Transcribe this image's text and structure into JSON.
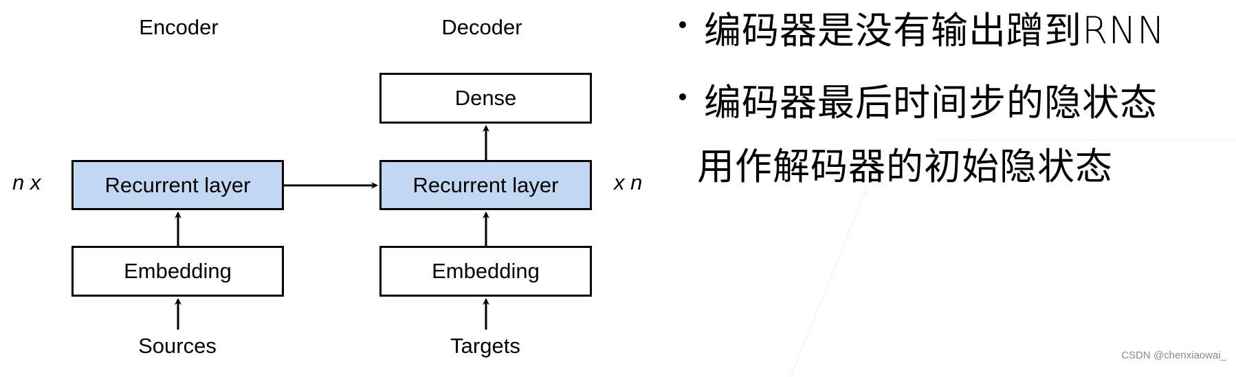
{
  "diagram": {
    "encoder": {
      "title": "Encoder",
      "repeat_label": "n x",
      "recurrent_label": "Recurrent layer",
      "embedding_label": "Embedding",
      "input_label": "Sources"
    },
    "decoder": {
      "title": "Decoder",
      "repeat_label": "x n",
      "dense_label": "Dense",
      "recurrent_label": "Recurrent layer",
      "embedding_label": "Embedding",
      "input_label": "Targets"
    },
    "colors": {
      "recurrent_fill": "#c2d7f4",
      "border": "#000000"
    },
    "edges": [
      {
        "from": "Sources",
        "to": "Encoder Embedding"
      },
      {
        "from": "Encoder Embedding",
        "to": "Encoder Recurrent layer"
      },
      {
        "from": "Encoder Recurrent layer",
        "to": "Decoder Recurrent layer"
      },
      {
        "from": "Targets",
        "to": "Decoder Embedding"
      },
      {
        "from": "Decoder Embedding",
        "to": "Decoder Recurrent layer"
      },
      {
        "from": "Decoder Recurrent layer",
        "to": "Dense"
      }
    ]
  },
  "notes": {
    "bullets": [
      "编码器是没有输出蹭到RNN",
      "编码器最后时间步的隐状态"
    ],
    "continuation": "用作解码器的初始隐状态"
  },
  "watermark": "CSDN @chenxiaowai_"
}
